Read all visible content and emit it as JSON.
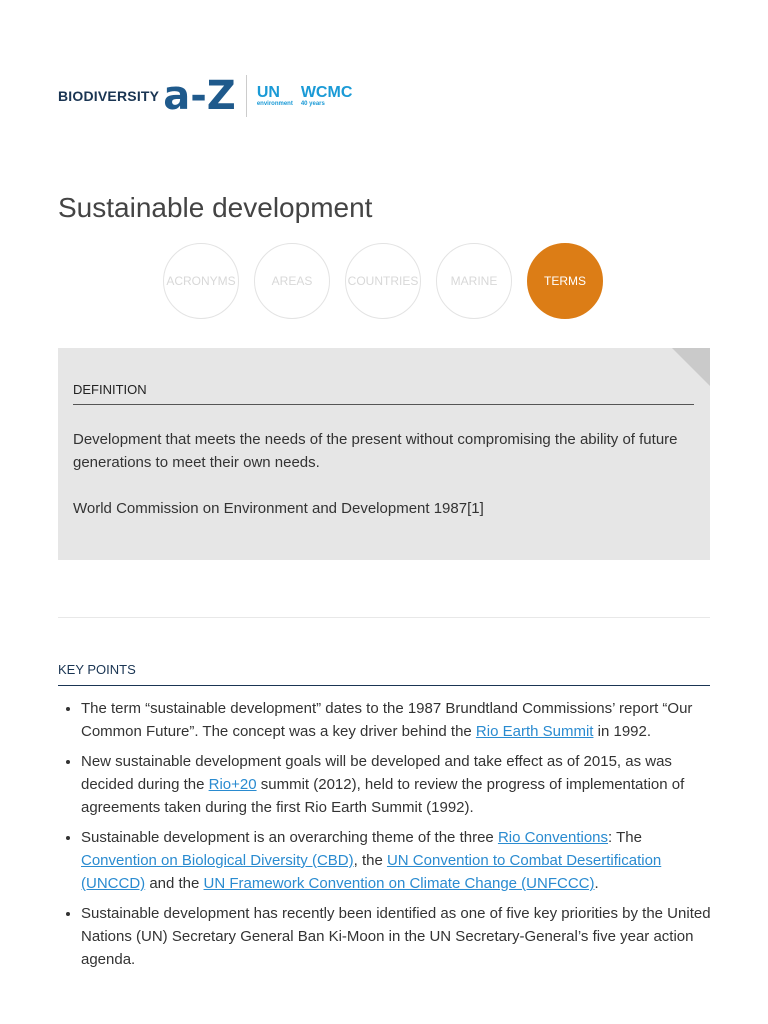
{
  "logo": {
    "biodiversity": "BIODIVERSITY",
    "az": "a-Z",
    "un": "UN",
    "un_sub": "environment",
    "wcmc": "WCMC",
    "wcmc_sub": "40 years"
  },
  "title": "Sustainable development",
  "nav": [
    "ACRONYMS",
    "AREAS",
    "COUNTRIES",
    "MARINE",
    "TERMS"
  ],
  "definition": {
    "label": "DEFINITION",
    "text": "Development that meets the needs of the present without compromising the ability of future generations to meet their own needs.",
    "source": "World Commission on Environment and Development 1987[1]"
  },
  "key_points": {
    "label": "KEY POINTS",
    "items": [
      {
        "a": "The term “sustainable development” dates to the 1987 Brundtland Commissions’ report “Our Common Future”. The concept was a key driver behind the ",
        "link1": "Rio Earth Summit",
        "b": " in 1992."
      },
      {
        "a": "New sustainable development goals will be developed and take effect as of 2015, as was decided during the ",
        "link1": "Rio+20",
        "b": " summit (2012), held to review the progress of implementation of agreements taken during the first Rio Earth Summit (1992)."
      },
      {
        "a": "Sustainable development is an overarching theme of the three ",
        "link1": "Rio Conventions",
        "b": ": The ",
        "link2": "Convention on Biological Diversity (CBD)",
        "c": ", the ",
        "link3": "UN Convention to Combat Desertification (UNCCD)",
        "d": " and the ",
        "link4": "UN Framework Convention on Climate Change (UNFCCC)",
        "e": "."
      },
      {
        "a": "Sustainable development has recently been identified as one of five key priorities by the United Nations (UN) Secretary General Ban Ki-Moon in the UN Secretary-General’s five year action agenda."
      }
    ]
  }
}
